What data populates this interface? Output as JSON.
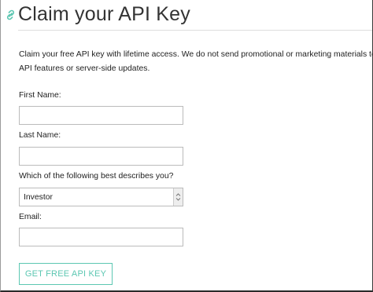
{
  "header": {
    "title": "Claim your API Key",
    "icon": "link-icon",
    "accent": "#5cc7b2"
  },
  "intro": {
    "line1": "Claim your free API key with lifetime access. We do not send promotional or marketing materials to our users.",
    "line2": "API features or server-side updates."
  },
  "form": {
    "first_name_label": "First Name:",
    "first_name_value": "",
    "last_name_label": "Last Name:",
    "last_name_value": "",
    "describe_label": "Which of the following best describes you?",
    "describe_selected": "Investor",
    "email_label": "Email:",
    "email_value": "",
    "submit_label": "GET FREE API KEY"
  }
}
